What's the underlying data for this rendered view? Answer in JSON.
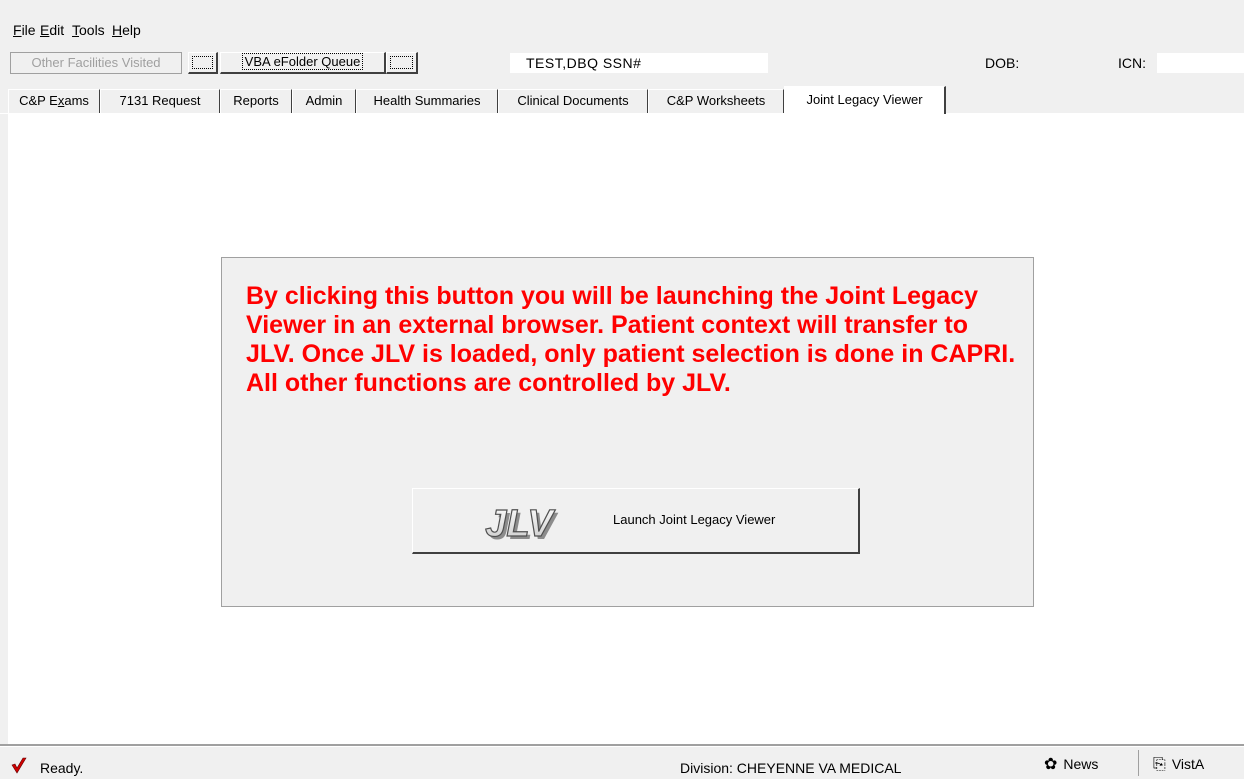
{
  "menu": {
    "file": {
      "hotkey": "F",
      "rest": "ile"
    },
    "edit": {
      "hotkey": "E",
      "rest": "dit"
    },
    "tools": {
      "hotkey": "T",
      "rest": "ools"
    },
    "help": {
      "hotkey": "H",
      "rest": "elp"
    }
  },
  "toolbar": {
    "other_facilities_label": "Other Facilities Visited",
    "efolder_queue_label": "VBA eFolder Queue",
    "patient_label": "TEST,DBQ  SSN#",
    "dob_label": "DOB:",
    "icn_label": "ICN:"
  },
  "tabs": [
    {
      "label": "C&P Exams",
      "pre": "C&P E",
      "hotkey": "x",
      "post": "ams"
    },
    {
      "label": "7131 Request"
    },
    {
      "label": "Reports"
    },
    {
      "label": "Admin"
    },
    {
      "label": "Health Summaries"
    },
    {
      "label": "Clinical Documents"
    },
    {
      "label": "C&P Worksheets"
    },
    {
      "label": "Joint Legacy Viewer"
    }
  ],
  "active_tab": "Joint Legacy Viewer",
  "panel": {
    "message": "By clicking this button you will be launching the Joint Legacy Viewer in an external browser. Patient context will transfer to JLV.  Once JLV is loaded, only patient selection is done in CAPRI.  All other functions are controlled by JLV.",
    "logo_text": "JLV",
    "launch_label": "Launch Joint Legacy Viewer"
  },
  "statusbar": {
    "status": "Ready.",
    "division": "Division: CHEYENNE VA MEDICAL",
    "news_label": "News",
    "vista_label": "VistA"
  },
  "icons": {
    "status": "checkmark-icon",
    "news": "news-icon",
    "vista": "printer-icon"
  },
  "colors": {
    "message": "#ff0000",
    "background": "#f0f0f0"
  }
}
